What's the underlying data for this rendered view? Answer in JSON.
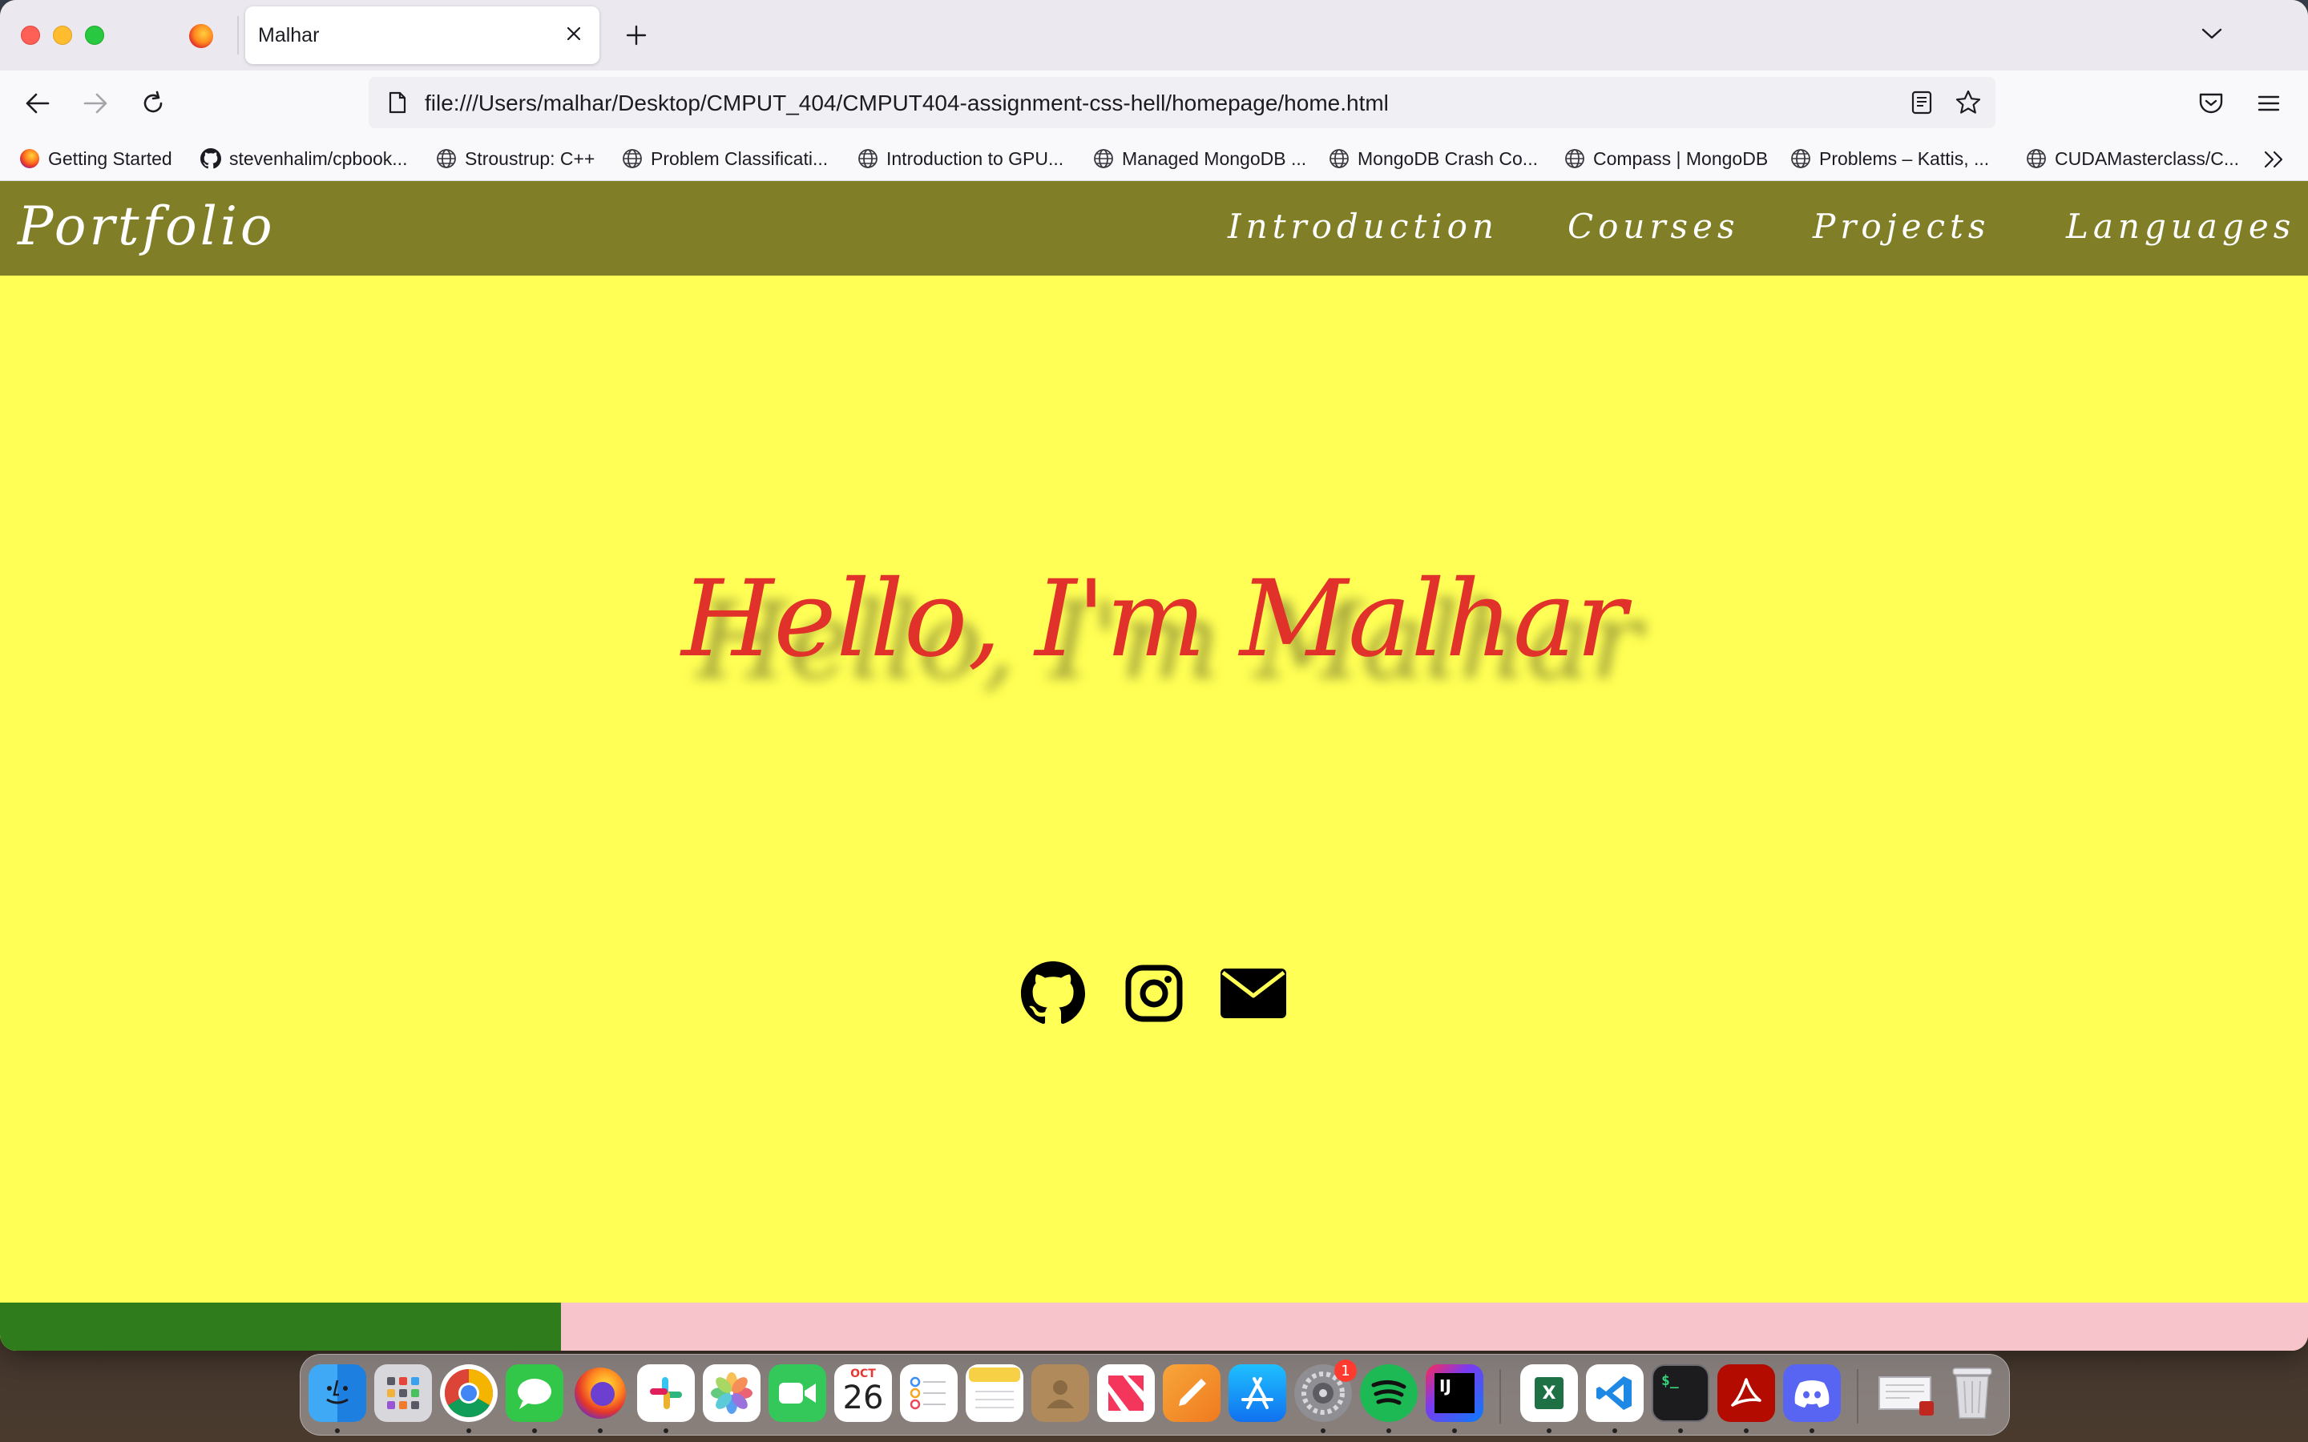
{
  "browser": {
    "tab": {
      "title": "Malhar"
    },
    "url": "file:///Users/malhar/Desktop/CMPUT_404/CMPUT404-assignment-css-hell/homepage/home.html",
    "bookmarks": [
      {
        "label": "Getting Started",
        "icon": "firefox-icon"
      },
      {
        "label": "stevenhalim/cpbook...",
        "icon": "github-icon"
      },
      {
        "label": "Stroustrup: C++",
        "icon": "globe-icon"
      },
      {
        "label": "Problem Classificati...",
        "icon": "globe-icon"
      },
      {
        "label": "Introduction to GPU...",
        "icon": "globe-icon"
      },
      {
        "label": "Managed MongoDB ...",
        "icon": "globe-icon"
      },
      {
        "label": "MongoDB Crash Co...",
        "icon": "globe-icon"
      },
      {
        "label": "Compass | MongoDB",
        "icon": "globe-icon"
      },
      {
        "label": "Problems – Kattis, ...",
        "icon": "globe-icon"
      },
      {
        "label": "CUDAMasterclass/C...",
        "icon": "globe-icon"
      }
    ]
  },
  "site": {
    "brand": "Portfolio",
    "nav": [
      "Introduction",
      "Courses",
      "Projects",
      "Languages"
    ],
    "hero": "Hello, I'm Malhar",
    "socials": [
      "github-icon",
      "instagram-icon",
      "mail-icon"
    ],
    "colors": {
      "nav_bg": "#807e26",
      "page_bg": "#ffff55",
      "hero_text": "#e0312a",
      "footer_left": "#2e7c1c",
      "footer_right": "#f8c4cc"
    }
  },
  "dock": {
    "calendar": {
      "month": "OCT",
      "day": "26"
    },
    "settings_badge": "1",
    "intellij_label": "IJ",
    "terminal_label": "$_",
    "excel_label": "X",
    "apps": [
      "Finder",
      "Launchpad",
      "Chrome",
      "Messages",
      "Firefox",
      "Slack",
      "Photos",
      "FaceTime",
      "Calendar",
      "Reminders",
      "Notes",
      "Contacts",
      "News",
      "Pages",
      "App Store",
      "System Preferences",
      "Spotify",
      "IntelliJ IDEA",
      "Excel",
      "VS Code",
      "Terminal",
      "Acrobat",
      "Discord",
      "Preview",
      "Trash"
    ]
  }
}
